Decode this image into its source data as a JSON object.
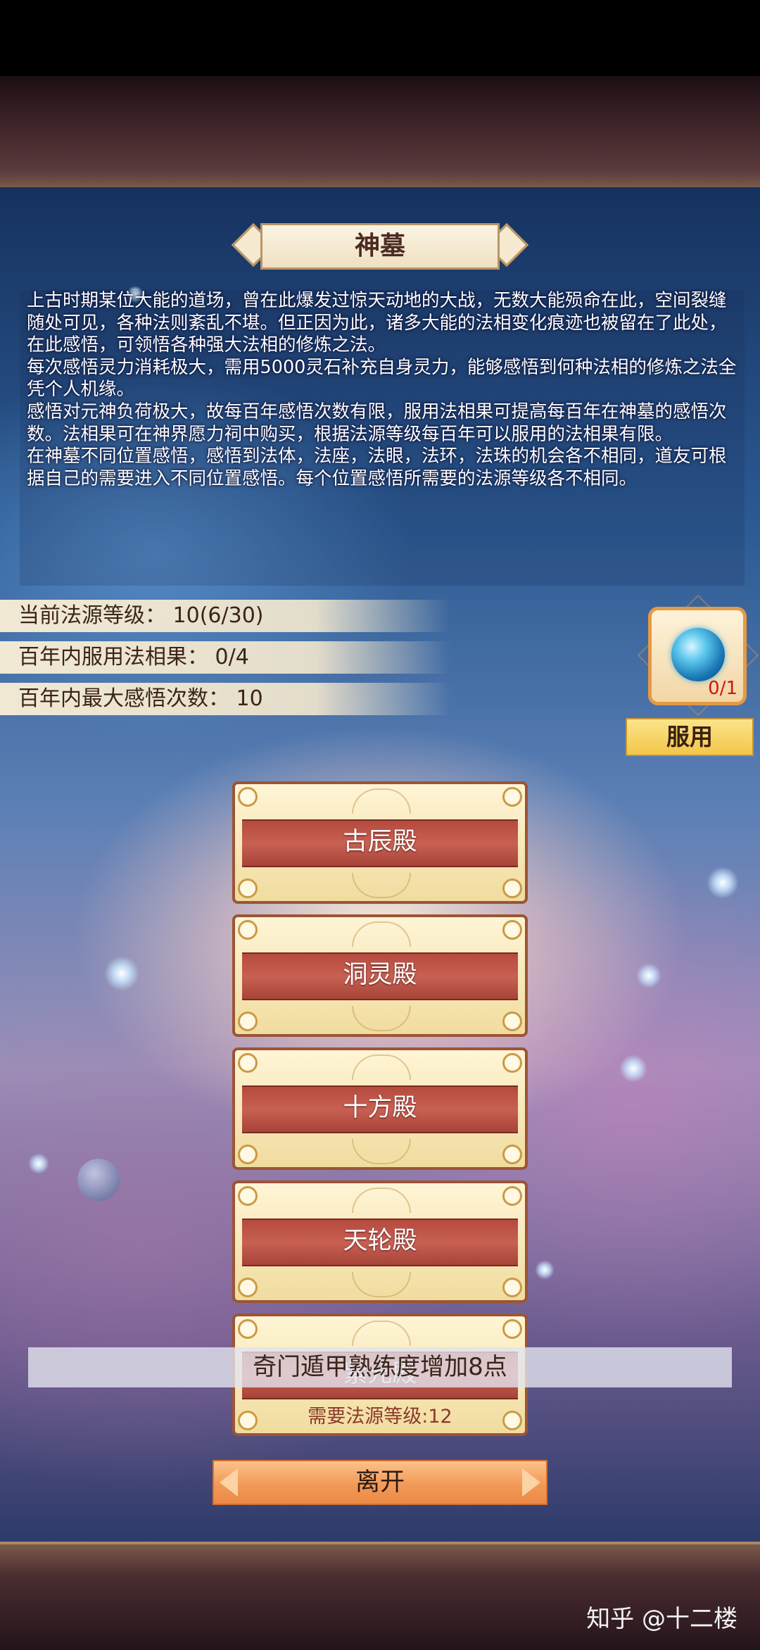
{
  "title": "神墓",
  "description": [
    "上古时期某位大能的道场，曾在此爆发过惊天动地的大战，无数大能殒命在此，空间裂缝随处可见，各种法则紊乱不堪。但正因为此，诸多大能的法相变化痕迹也被留在了此处，在此感悟，可领悟各种强大法相的修炼之法。",
    "每次感悟灵力消耗极大，需用5000灵石补充自身灵力，能够感悟到何种法相的修炼之法全凭个人机缘。",
    "感悟对元神负荷极大，故每百年感悟次数有限，服用法相果可提高每百年在神墓的感悟次数。法相果可在神界愿力祠中购买，根据法源等级每百年可以服用的法相果有限。",
    "在神墓不同位置感悟，感悟到法体，法座，法眼，法环，法珠的机会各不相同，道友可根据自己的需要进入不同位置感悟。每个位置感悟所需要的法源等级各不相同。"
  ],
  "stats": {
    "level": "当前法源等级：  10(6/30)",
    "fruit_used": "百年内服用法相果：  0/4",
    "max_insight": "百年内最大感悟次数：  10"
  },
  "item": {
    "icon": "blue-orb-icon",
    "count": "0/1",
    "use_label": "服用"
  },
  "halls": [
    {
      "label": "古辰殿"
    },
    {
      "label": "洞灵殿"
    },
    {
      "label": "十方殿"
    },
    {
      "label": "天轮殿"
    },
    {
      "label": "紫元殿",
      "requirement": "需要法源等级:12"
    }
  ],
  "toast": "奇门遁甲熟练度增加8点",
  "leave_label": "离开",
  "watermark": "知乎 @十二楼",
  "colors": {
    "hall_band": "#b54a3e",
    "hall_scroll": "#f6e6b8",
    "leave_button": "#f29a58",
    "use_button": "#f3c64a",
    "item_count": "#d01616"
  }
}
